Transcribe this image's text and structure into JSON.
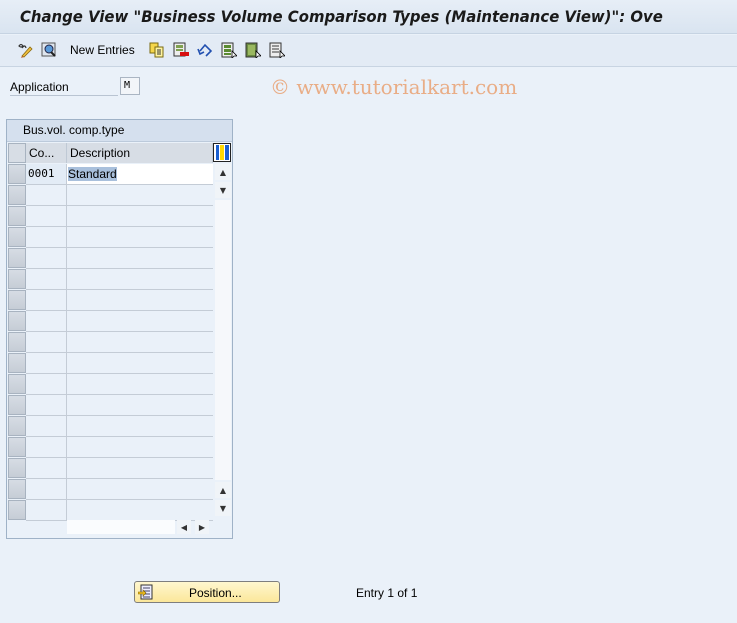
{
  "window": {
    "title": "Change View \"Business Volume Comparison Types (Maintenance View)\": Ove"
  },
  "toolbar": {
    "items": [
      {
        "icon": "display-change-icon",
        "tooltip": ""
      },
      {
        "icon": "find-icon"
      },
      {
        "label": "New Entries"
      },
      {
        "icon": "copy-as-icon"
      },
      {
        "icon": "delete-icon"
      },
      {
        "icon": "undo-change-icon"
      },
      {
        "icon": "select-all-icon"
      },
      {
        "icon": "select-block-icon"
      },
      {
        "icon": "deselect-all-icon"
      }
    ],
    "new_entries_label": "New Entries"
  },
  "watermark": "© www.tutorialkart.com",
  "form": {
    "application_label": "Application",
    "application_value": "M"
  },
  "table": {
    "caption": "Bus.vol. comp.type",
    "columns": [
      "Co...",
      "Description"
    ],
    "rows": [
      {
        "code": "0001",
        "description": "Standard"
      }
    ],
    "empty_rows": 16
  },
  "footer": {
    "position_button": "Position...",
    "entry_text": "Entry 1 of 1"
  }
}
